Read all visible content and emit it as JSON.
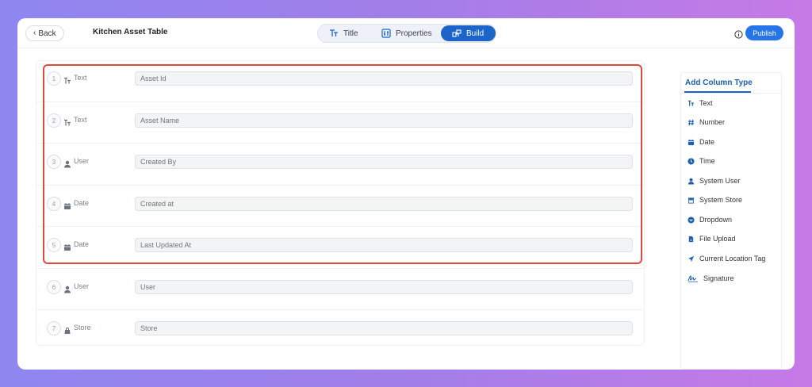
{
  "header": {
    "back_label": "Back",
    "title": "Kitchen Asset Table",
    "tabs": [
      {
        "label": "Title",
        "icon": "text-format-icon"
      },
      {
        "label": "Properties",
        "icon": "properties-icon"
      },
      {
        "label": "Build",
        "icon": "build-icon",
        "active": true
      }
    ],
    "publish_label": "Publish"
  },
  "rows": [
    {
      "num": "1",
      "type": "Text",
      "icon": "text-type-icon",
      "placeholder": "Asset Id"
    },
    {
      "num": "2",
      "type": "Text",
      "icon": "text-type-icon",
      "placeholder": "Asset Name"
    },
    {
      "num": "3",
      "type": "User",
      "icon": "user-icon",
      "placeholder": "Created By"
    },
    {
      "num": "4",
      "type": "Date",
      "icon": "calendar-icon",
      "placeholder": "Created at"
    },
    {
      "num": "5",
      "type": "Date",
      "icon": "calendar-icon",
      "placeholder": "Last Updated At"
    },
    {
      "num": "6",
      "type": "User",
      "icon": "user-icon",
      "placeholder": "User"
    },
    {
      "num": "7",
      "type": "Store",
      "icon": "store-icon",
      "placeholder": "Store"
    }
  ],
  "sidebar": {
    "title": "Add Column Type",
    "items": [
      {
        "label": "Text",
        "icon": "text-type-icon"
      },
      {
        "label": "Number",
        "icon": "hash-icon"
      },
      {
        "label": "Date",
        "icon": "calendar-icon"
      },
      {
        "label": "Time",
        "icon": "clock-icon"
      },
      {
        "label": "System User",
        "icon": "user-icon"
      },
      {
        "label": "System Store",
        "icon": "store-icon"
      },
      {
        "label": "Dropdown",
        "icon": "dropdown-icon"
      },
      {
        "label": "File Upload",
        "icon": "file-icon"
      },
      {
        "label": "Current Location Tag",
        "icon": "location-arrow-icon"
      },
      {
        "label": "Signature",
        "icon": "signature-icon"
      }
    ]
  },
  "colors": {
    "accent": "#1c64c8",
    "publish": "#2575e8",
    "highlight": "#e0493b"
  }
}
